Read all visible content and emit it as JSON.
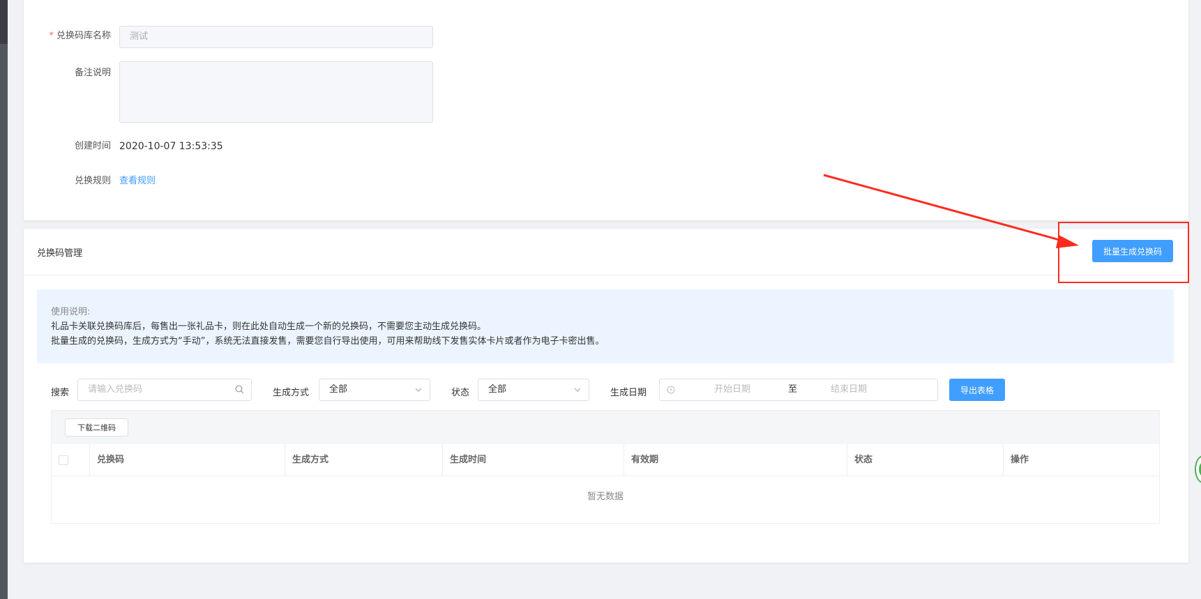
{
  "form": {
    "name_label": "兑换码库名称",
    "name_value": "测试",
    "remark_label": "备注说明",
    "created_label": "创建时间",
    "created_value": "2020-10-07 13:53:35",
    "rule_label": "兑换规则",
    "rule_link": "查看规则"
  },
  "section": {
    "title": "兑换码管理",
    "batch_button": "批量生成兑换码"
  },
  "notice": {
    "title": "使用说明:",
    "line1": "礼品卡关联兑换码库后，每售出一张礼品卡，则在此处自动生成一个新的兑换码，不需要您主动生成兑换码。",
    "line2": "批量生成的兑换码，生成方式为“手动”，系统无法直接发售，需要您自行导出使用，可用来帮助线下发售实体卡片或者作为电子卡密出售。"
  },
  "filters": {
    "search_label": "搜索",
    "search_placeholder": "请输入兑换码",
    "method_label": "生成方式",
    "method_value": "全部",
    "status_label": "状态",
    "status_value": "全部",
    "date_label": "生成日期",
    "start_placeholder": "开始日期",
    "date_separator": "至",
    "end_placeholder": "结束日期",
    "export_button": "导出表格"
  },
  "table": {
    "download_button": "下载二维码",
    "columns": [
      "兑换码",
      "生成方式",
      "生成时间",
      "有效期",
      "状态",
      "操作"
    ],
    "empty_text": "暂无数据"
  },
  "colors": {
    "primary": "#409eff",
    "annotation": "#ff2a1f"
  }
}
